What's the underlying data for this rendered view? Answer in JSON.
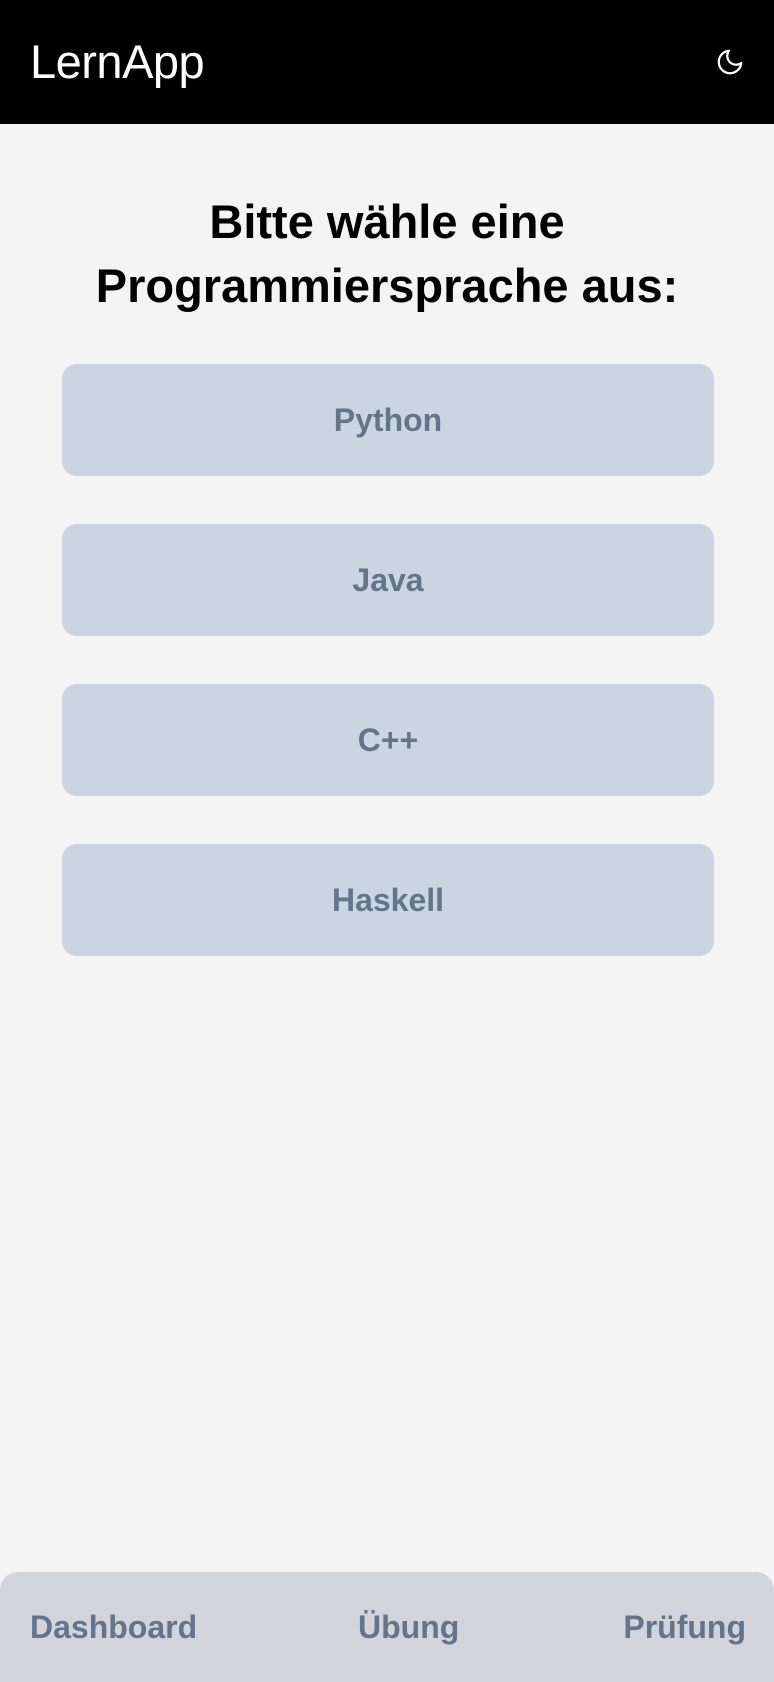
{
  "header": {
    "title": "LernApp",
    "theme_icon": "moon-icon"
  },
  "main": {
    "prompt_line1": "Bitte wähle eine",
    "prompt_line2": "Programmiersprache aus:",
    "languages": [
      {
        "label": "Python"
      },
      {
        "label": "Java"
      },
      {
        "label": "C++"
      },
      {
        "label": "Haskell"
      }
    ]
  },
  "bottom_nav": {
    "items": [
      {
        "label": "Dashboard"
      },
      {
        "label": "Übung"
      },
      {
        "label": "Prüfung"
      }
    ]
  },
  "colors": {
    "header_bg": "#000000",
    "page_bg": "#f4f4f5",
    "button_bg": "#cbd5e1",
    "button_text": "#64748b",
    "nav_bg": "#d1d5db"
  }
}
